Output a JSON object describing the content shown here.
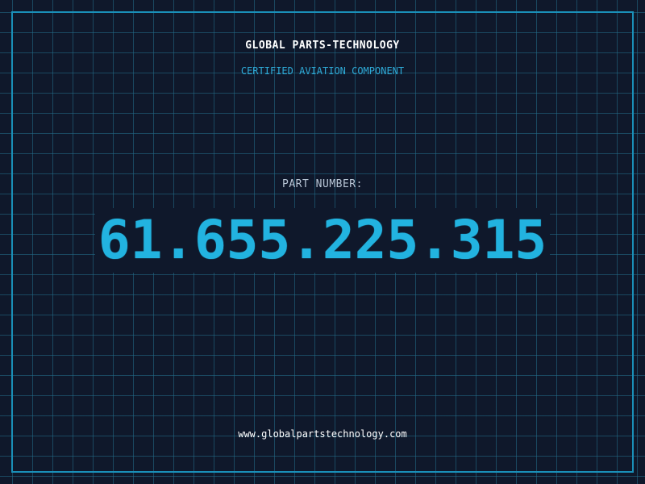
{
  "brand": {
    "name": "GLOBAL PARTS-TECHNOLOGY",
    "subtitle": "CERTIFIED AVIATION COMPONENT"
  },
  "part": {
    "label": "PART NUMBER:",
    "number": "61.655.225.315"
  },
  "footer": {
    "website": "www.globalpartstechnology.com"
  },
  "colors": {
    "background": "#0f182b",
    "grid": "#236e8c",
    "frame": "#1a8fb8",
    "accent": "#22b3e0",
    "subtitle": "#2ea9d6",
    "label": "#b9c6d6",
    "text": "#ffffff"
  }
}
